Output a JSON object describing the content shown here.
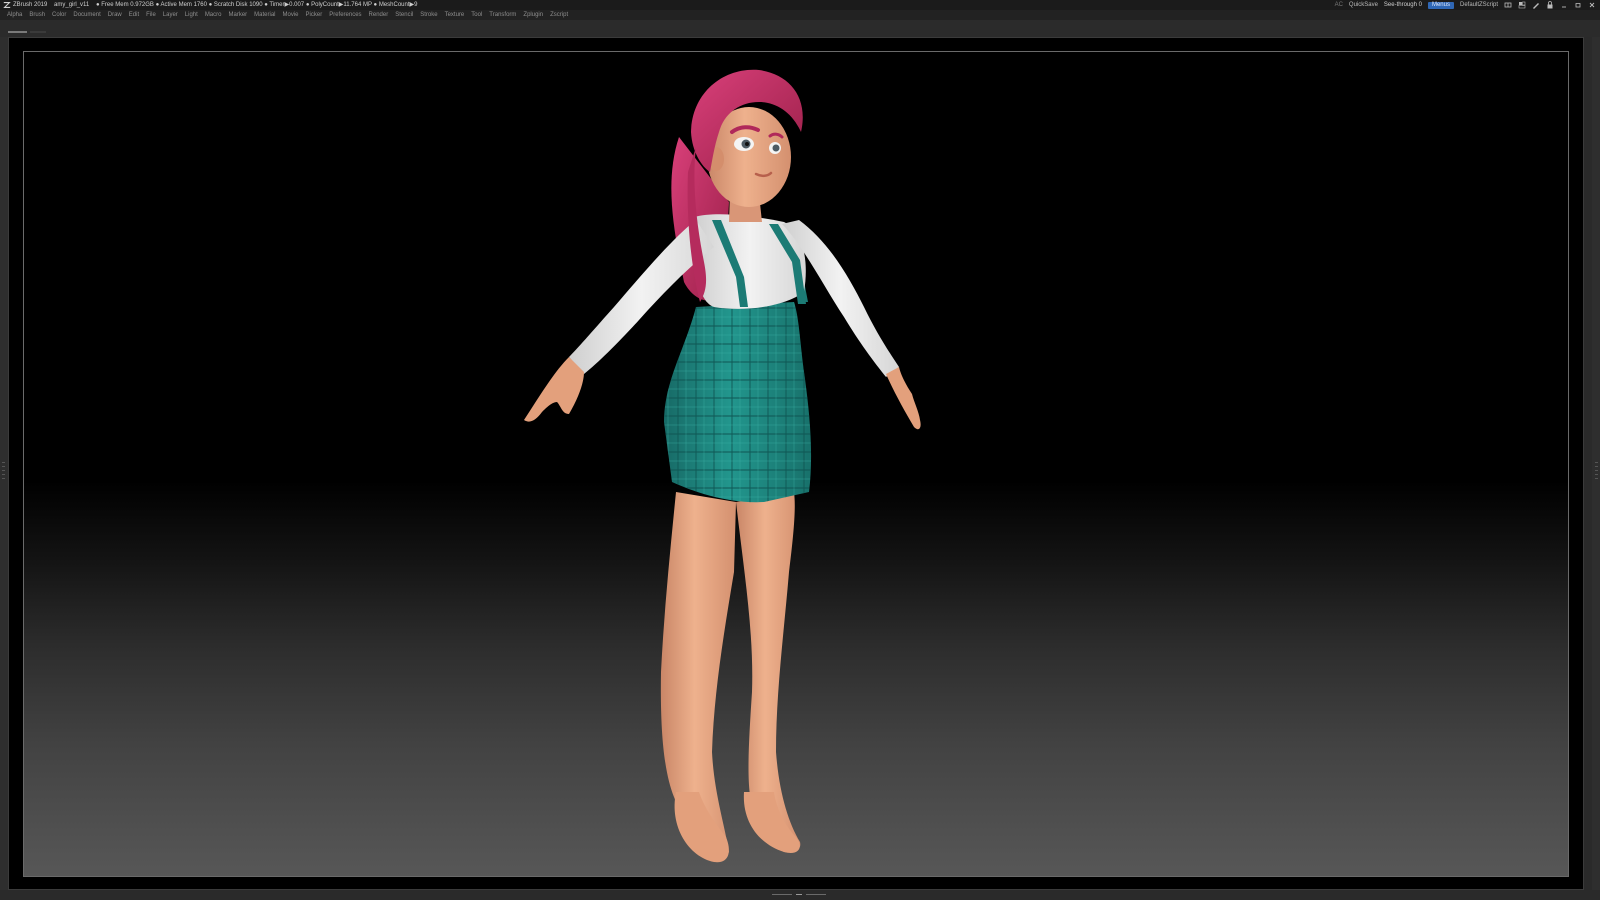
{
  "titlebar": {
    "app": "ZBrush 2019",
    "file": "amy_girl_v11",
    "stats": "● Free Mem 0.972GB ● Active Mem 1760 ● Scratch Disk 1090 ● Timer▶0.007 ● PolyCount▶11.764 MP ● MeshCount▶9",
    "ac": "AC",
    "quicksave": "QuickSave",
    "seethrough_label": "See-through",
    "seethrough_value": "0",
    "seethrough_fraction": 0,
    "menus_toggle": "Menus",
    "zscript": "DefaultZScript"
  },
  "menubar": {
    "items": [
      "Alpha",
      "Brush",
      "Color",
      "Document",
      "Draw",
      "Edit",
      "File",
      "Layer",
      "Light",
      "Macro",
      "Marker",
      "Material",
      "Movie",
      "Picker",
      "Preferences",
      "Render",
      "Stencil",
      "Stroke",
      "Texture",
      "Tool",
      "Transform",
      "Zplugin",
      "Zscript"
    ]
  },
  "colors": {
    "accent": "#2f67b5",
    "seethrough_fill": "#d4b000",
    "hair": "#c2305f",
    "skin": "#e6a57f",
    "shirt": "#e8e8e8",
    "skirt": "#1f8c84"
  },
  "icons": [
    "zbrush-logo-icon",
    "layout-icon",
    "palette-icon",
    "brush-icon",
    "lock-icon",
    "minimize-icon",
    "restore-icon",
    "close-icon"
  ]
}
